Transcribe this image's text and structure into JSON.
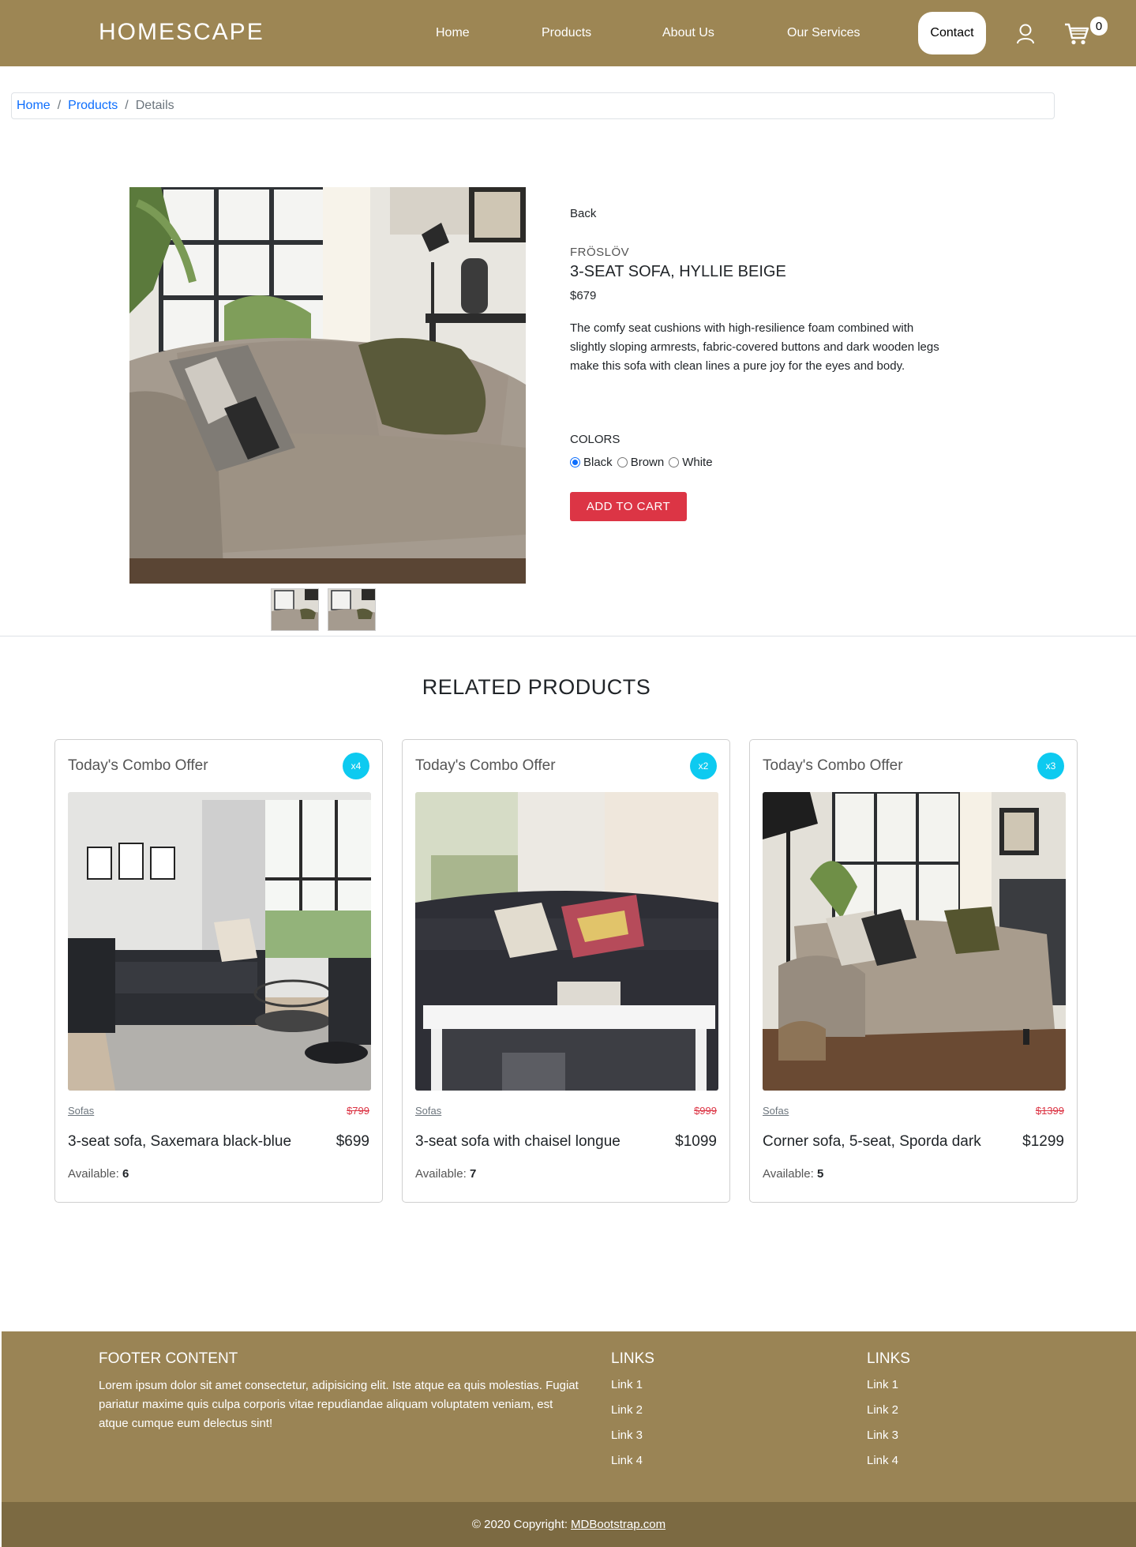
{
  "navbar": {
    "brand": "HOMESCAPE",
    "links": [
      "Home",
      "Products",
      "About Us",
      "Our Services"
    ],
    "contact": "Contact",
    "cart_count": "0",
    "bg_color": "#9d8654"
  },
  "breadcrumb": {
    "home": "Home",
    "products": "Products",
    "current": "Details"
  },
  "product": {
    "back": "Back",
    "brand": "FRÖSLÖV",
    "title": "3-SEAT SOFA, HYLLIE BEIGE",
    "price": "$679",
    "description": "The comfy seat cushions with high-resilience foam combined with slightly sloping armrests, fabric-covered buttons and dark wooden legs make this sofa with clean lines a pure joy for the eyes and body.",
    "colors_title": "COLORS",
    "colors": [
      "Black",
      "Brown",
      "White"
    ],
    "selected_color": "Black",
    "add_to_cart": "ADD TO CART"
  },
  "related": {
    "title": "RELATED PRODUCTS",
    "cards": [
      {
        "header": "Today's Combo Offer",
        "badge": "x4",
        "category": "Sofas",
        "old_price": "$799",
        "name": "3-seat sofa, Saxemara black-blue",
        "price": "$699",
        "available_label": "Available:",
        "available": "6"
      },
      {
        "header": "Today's Combo Offer",
        "badge": "x2",
        "category": "Sofas",
        "old_price": "$999",
        "name": "3-seat sofa with chaisel longue",
        "price": "$1099",
        "available_label": "Available:",
        "available": "7"
      },
      {
        "header": "Today's Combo Offer",
        "badge": "x3",
        "category": "Sofas",
        "old_price": "$1399",
        "name": "Corner sofa, 5-seat, Sporda dark",
        "price": "$1299",
        "available_label": "Available:",
        "available": "5"
      }
    ]
  },
  "footer": {
    "content_title": "FOOTER CONTENT",
    "content_text": "Lorem ipsum dolor sit amet consectetur, adipisicing elit. Iste atque ea quis molestias. Fugiat pariatur maxime quis culpa corporis vitae repudiandae aliquam voluptatem veniam, est atque cumque eum delectus sint!",
    "links_title_1": "LINKS",
    "links_1": [
      "Link 1",
      "Link 2",
      "Link 3",
      "Link 4"
    ],
    "links_title_2": "LINKS",
    "links_2": [
      "Link 1",
      "Link 2",
      "Link 3",
      "Link 4"
    ],
    "copyright": "© 2020 Copyright:",
    "copyright_link": "MDBootstrap.com"
  }
}
